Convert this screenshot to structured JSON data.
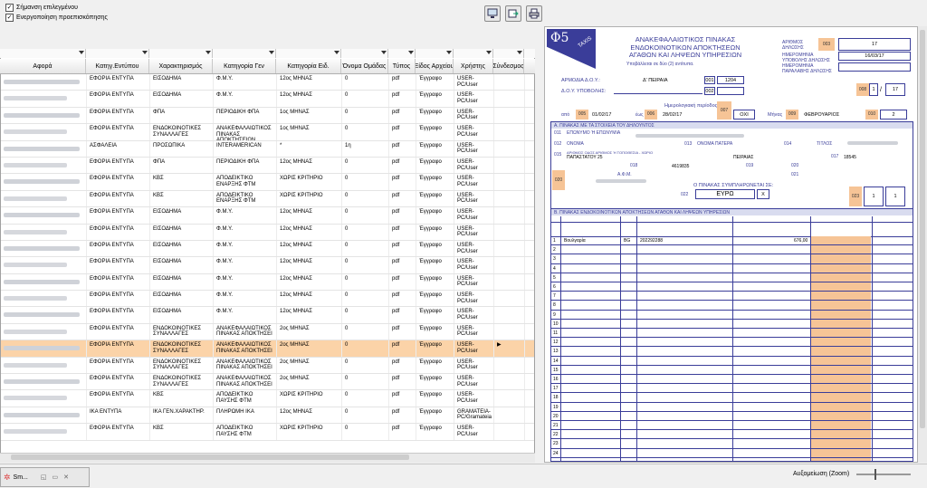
{
  "toolbar": {
    "chk_mark_selected": "Σήμανση επιλεγμένου",
    "chk_enable_preview": "Ενεργοποίηση προεπισκόπησης"
  },
  "grid": {
    "columns": [
      "Αφορά",
      "Κατηγ.Εντύπου",
      "Χαρακτηρισμός",
      "Κατηγορία Γεν",
      "Κατηγορία Ειδ.",
      "Όνομα Ομάδας",
      "Τύπος",
      "Είδος Αρχείου",
      "Χρήστης",
      "Σύνδεσμος"
    ],
    "rows": [
      {
        "kat": "ΕΦΟΡΙΑ ΕΝΤΥΠΑ",
        "xar": "ΕΙΣΟΔΗΜΑ",
        "gen": "Φ.Μ.Υ.",
        "eid": "12ος ΜΗΝΑΣ",
        "grp": "0",
        "typ": "pdf",
        "file": "Έγγραφο",
        "user": "USER-PC/User"
      },
      {
        "kat": "ΕΦΟΡΙΑ ΕΝΤΥΠΑ",
        "xar": "ΕΙΣΟΔΗΜΑ",
        "gen": "Φ.Μ.Υ.",
        "eid": "12ος ΜΗΝΑΣ",
        "grp": "0",
        "typ": "pdf",
        "file": "Έγγραφο",
        "user": "USER-PC/User"
      },
      {
        "kat": "ΕΦΟΡΙΑ ΕΝΤΥΠΑ",
        "xar": "ΦΠΑ",
        "gen": "ΠΕΡΙΟΔΙΚΗ ΦΠΑ",
        "eid": "1ος ΜΗΝΑΣ",
        "grp": "0",
        "typ": "pdf",
        "file": "Έγγραφο",
        "user": "USER-PC/User"
      },
      {
        "kat": "ΕΦΟΡΙΑ ΕΝΤΥΠΑ",
        "xar": "ΕΝΔΟΚΟΙΝΟΤΙΚΕΣ ΣΥΝΑΛΛΑΓΕΣ",
        "gen": "ΑΝΑΚΕΦΑΛΑΙΩΤΙΚΟΣ ΠΙΝΑΚΑΣ ΑΠΟΚΤΗΣΕΙΩΝ",
        "eid": "1ος ΜΗΝΑΣ",
        "grp": "0",
        "typ": "pdf",
        "file": "Έγγραφο",
        "user": "USER-PC/User"
      },
      {
        "kat": "ΑΣΦΑΛΕΙΑ",
        "xar": "ΠΡΟΣΩΠΙΚΑ",
        "gen": "INTERAMERICAN",
        "eid": "*",
        "grp": "1η",
        "typ": "pdf",
        "file": "Έγγραφο",
        "user": "USER-PC/User"
      },
      {
        "kat": "ΕΦΟΡΙΑ ΕΝΤΥΠΑ",
        "xar": "ΦΠΑ",
        "gen": "ΠΕΡΙΟΔΙΚΗ ΦΠΑ",
        "eid": "12ος ΜΗΝΑΣ",
        "grp": "0",
        "typ": "pdf",
        "file": "Έγγραφο",
        "user": "USER-PC/User"
      },
      {
        "kat": "ΕΦΟΡΙΑ ΕΝΤΥΠΑ",
        "xar": "ΚΒΣ",
        "gen": "ΑΠΟΔΕΙΚΤΙΚΟ ΕΝΑΡΞΗΣ ΦΤΜ",
        "eid": "ΧΩΡΙΣ ΚΡΙΤΗΡΙΟ",
        "grp": "0",
        "typ": "pdf",
        "file": "Έγγραφο",
        "user": "USER-PC/User"
      },
      {
        "kat": "ΕΦΟΡΙΑ ΕΝΤΥΠΑ",
        "xar": "ΚΒΣ",
        "gen": "ΑΠΟΔΕΙΚΤΙΚΟ ΕΝΑΡΞΗΣ ΦΤΜ",
        "eid": "ΧΩΡΙΣ ΚΡΙΤΗΡΙΟ",
        "grp": "0",
        "typ": "pdf",
        "file": "Έγγραφο",
        "user": "USER-PC/User"
      },
      {
        "kat": "ΕΦΟΡΙΑ ΕΝΤΥΠΑ",
        "xar": "ΕΙΣΟΔΗΜΑ",
        "gen": "Φ.Μ.Υ.",
        "eid": "12ος ΜΗΝΑΣ",
        "grp": "0",
        "typ": "pdf",
        "file": "Έγγραφο",
        "user": "USER-PC/User"
      },
      {
        "kat": "ΕΦΟΡΙΑ ΕΝΤΥΠΑ",
        "xar": "ΕΙΣΟΔΗΜΑ",
        "gen": "Φ.Μ.Υ.",
        "eid": "12ος ΜΗΝΑΣ",
        "grp": "0",
        "typ": "pdf",
        "file": "Έγγραφο",
        "user": "USER-PC/User"
      },
      {
        "kat": "ΕΦΟΡΙΑ ΕΝΤΥΠΑ",
        "xar": "ΕΙΣΟΔΗΜΑ",
        "gen": "Φ.Μ.Υ.",
        "eid": "12ος ΜΗΝΑΣ",
        "grp": "0",
        "typ": "pdf",
        "file": "Έγγραφο",
        "user": "USER-PC/User"
      },
      {
        "kat": "ΕΦΟΡΙΑ ΕΝΤΥΠΑ",
        "xar": "ΕΙΣΟΔΗΜΑ",
        "gen": "Φ.Μ.Υ.",
        "eid": "12ος ΜΗΝΑΣ",
        "grp": "0",
        "typ": "pdf",
        "file": "Έγγραφο",
        "user": "USER-PC/User"
      },
      {
        "kat": "ΕΦΟΡΙΑ ΕΝΤΥΠΑ",
        "xar": "ΕΙΣΟΔΗΜΑ",
        "gen": "Φ.Μ.Υ.",
        "eid": "12ος ΜΗΝΑΣ",
        "grp": "0",
        "typ": "pdf",
        "file": "Έγγραφο",
        "user": "USER-PC/User"
      },
      {
        "kat": "ΕΦΟΡΙΑ ΕΝΤΥΠΑ",
        "xar": "ΕΙΣΟΔΗΜΑ",
        "gen": "Φ.Μ.Υ.",
        "eid": "12ος ΜΗΝΑΣ",
        "grp": "0",
        "typ": "pdf",
        "file": "Έγγραφο",
        "user": "USER-PC/User"
      },
      {
        "kat": "ΕΦΟΡΙΑ ΕΝΤΥΠΑ",
        "xar": "ΕΙΣΟΔΗΜΑ",
        "gen": "Φ.Μ.Υ.",
        "eid": "12ος ΜΗΝΑΣ",
        "grp": "0",
        "typ": "pdf",
        "file": "Έγγραφο",
        "user": "USER-PC/User"
      },
      {
        "kat": "ΕΦΟΡΙΑ ΕΝΤΥΠΑ",
        "xar": "ΕΝΔΟΚΟΙΝΟΤΙΚΕΣ ΣΥΝΑΛΛΑΓΕΣ",
        "gen": "ΑΝΑΚΕΦΑΛΑΙΩΤΙΚΟΣ ΠΙΝΑΚΑΣ ΑΠΟΚΤΗΣΕΙ",
        "eid": "2ος ΜΗΝΑΣ",
        "grp": "0",
        "typ": "pdf",
        "file": "Έγγραφο",
        "user": "USER-PC/User"
      },
      {
        "kat": "ΕΦΟΡΙΑ ΕΝΤΥΠΑ",
        "xar": "ΕΝΔΟΚΟΙΝΟΤΙΚΕΣ ΣΥΝΑΛΛΑΓΕΣ",
        "gen": "ΑΝΑΚΕΦΑΛΑΙΩΤΙΚΟΣ ΠΙΝΑΚΑΣ ΑΠΟΚΤΗΣΕΙ",
        "eid": "2ος ΜΗΝΑΣ",
        "grp": "0",
        "typ": "pdf",
        "file": "Έγγραφο",
        "user": "USER-PC/User"
      },
      {
        "kat": "ΕΦΟΡΙΑ ΕΝΤΥΠΑ",
        "xar": "ΕΝΔΟΚΟΙΝΟΤΙΚΕΣ ΣΥΝΑΛΛΑΓΕΣ",
        "gen": "ΑΝΑΚΕΦΑΛΑΙΩΤΙΚΟΣ ΠΙΝΑΚΑΣ ΑΠΟΚΤΗΣΕΙ",
        "eid": "2ος ΜΗΝΑΣ",
        "grp": "0",
        "typ": "pdf",
        "file": "Έγγραφο",
        "user": "USER-PC/User"
      },
      {
        "kat": "ΕΦΟΡΙΑ ΕΝΤΥΠΑ",
        "xar": "ΕΝΔΟΚΟΙΝΟΤΙΚΕΣ ΣΥΝΑΛΛΑΓΕΣ",
        "gen": "ΑΝΑΚΕΦΑΛΑΙΩΤΙΚΟΣ ΠΙΝΑΚΑΣ ΑΠΟΚΤΗΣΕΙ",
        "eid": "2ος ΜΗΝΑΣ",
        "grp": "0",
        "typ": "pdf",
        "file": "Έγγραφο",
        "user": "USER-PC/User"
      },
      {
        "kat": "ΕΦΟΡΙΑ ΕΝΤΥΠΑ",
        "xar": "ΚΒΣ",
        "gen": "ΑΠΟΔΕΙΚΤΙΚΟ ΠΑΥΣΗΣ ΦΤΜ",
        "eid": "ΧΩΡΙΣ ΚΡΙΤΗΡΙΟ",
        "grp": "0",
        "typ": "pdf",
        "file": "Έγγραφο",
        "user": "USER-PC/User"
      },
      {
        "kat": "ΙΚΑ ΕΝΤΥΠΑ",
        "xar": "ΙΚΑ ΓΕΝ.ΧΑΡΑΚΤΗΡ.",
        "gen": "ΠΛΗΡΩΜΗ ΙΚΑ",
        "eid": "12ος ΜΗΝΑΣ",
        "grp": "0",
        "typ": "pdf",
        "file": "Έγγραφο",
        "user": "GRAMATEIA-PC/Gramateia"
      },
      {
        "kat": "ΕΦΟΡΙΑ ΕΝΤΥΠΑ",
        "xar": "ΚΒΣ",
        "gen": "ΑΠΟΔΕΙΚΤΙΚΟ ΠΑΥΣΗΣ ΦΤΜ",
        "eid": "ΧΩΡΙΣ ΚΡΙΤΗΡΙΟ",
        "grp": "0",
        "typ": "pdf",
        "file": "Έγγραφο",
        "user": "USER-PC/User"
      }
    ],
    "selected_row": 16
  },
  "form": {
    "logo": "Φ5",
    "taxis": "TAXIS",
    "title_l1": "ΑΝΑΚΕΦΑΛΑΙΩΤΙΚΟΣ ΠΙΝΑΚΑΣ",
    "title_l2": "ΕΝΔΟΚΟΙΝΟΤΙΚΩΝ ΑΠΟΚΤΗΣΕΩΝ",
    "title_l3": "ΑΓΑΘΩΝ ΚΑΙ ΛΗΨΕΩΝ ΥΠΗΡΕΣΙΩΝ",
    "subtitle": "Υποβάλλεται σε δύο (2) αντίτυπα.",
    "doy_label": "ΑΡΜΟΔΙΑ Δ.Ο.Υ.:",
    "doy_value": "Δ' ΠΕΙΡΑΙΑ",
    "doy_code": "1204",
    "doy2_label": "Δ.Ο.Υ. ΥΠΟΒΟΛΗΣ:",
    "num_decl": "17",
    "date_decl": "16/03/17",
    "period_label": "Ημερολογιακή περίοδος",
    "from_label": "από",
    "from_val": "01/02/17",
    "to_label": "έως",
    "to_val": "28/02/17",
    "no_val": "ΟΧΙ",
    "month_label": "Μήνας",
    "month_val": "ΦΕΒΡΟΥΑΡΙΟΣ",
    "month_num": "2",
    "page": "1",
    "page_total": "17",
    "sec_a": "Α. ΠΙΝΑΚΑΣ ΜΕ ΤΑ ΣΤΟΙΧΕΙΑ ΤΟΥ ΔΗΛΟΥΝΤΟΣ",
    "name_lbl": "ΕΠΩΝΥΜΟ Ή ΕΠΩΝΥΜΙΑ",
    "onoma": "ΟΝΟΜΑ",
    "onoma_patera": "ΟΝΟΜΑ ΠΑΤΕΡΑ",
    "titlos": "ΤΙΤΛΟΣ",
    "address_lbl": "ΑΡΙΘΜΟΣ ΟΔΟΣ ΑΡΙΘΜΟΣ Ή ΤΟΠΟΘΕΣΙΑ - ΧΩΡΙΟ",
    "street": "ΠΑΠΑΣΤΑΤΟΥ 25",
    "city": "ΠΕΙΡΑΙΑΣ",
    "tk": "18545",
    "phone": "4619835",
    "afm_lbl": "Α.Φ.Μ.",
    "currency_lbl": "Ο ΠΙΝΑΚΑΣ ΣΥΜΠΛΗΡΩΝΕΤΑΙ ΣΕ:",
    "currency": "ΕΥΡΩ",
    "x_mark": "X",
    "sec_b": "Β. ΠΙΝΑΚΑΣ ΕΝΔΟΚΟΙΝΟΤΙΚΩΝ ΑΠΟΚΤΗΣΕΩΝ ΑΓΑΘΩΝ ΚΑΙ ΛΗΨΕΩΝ ΥΠΗΡΕΣΙΩΝ",
    "r1_country": "Βουλγαρία",
    "r1_code": "BG",
    "r1_vat": "202292288",
    "r1_amount": "676,00",
    "line_numbers": [
      "1",
      "2",
      "3",
      "4",
      "5",
      "6",
      "7",
      "8",
      "9",
      "10",
      "11",
      "12",
      "13",
      "14",
      "15",
      "16",
      "17",
      "18",
      "19",
      "20",
      "21",
      "22",
      "23",
      "24"
    ]
  },
  "taskbar": {
    "tab_label": "Sm...",
    "zoom_label": "Αυξομείωση (Zoom)"
  },
  "colors": {
    "selected_row": "#fbd3a8",
    "form_blue": "#3a3d99",
    "form_orange": "#f6c496"
  }
}
